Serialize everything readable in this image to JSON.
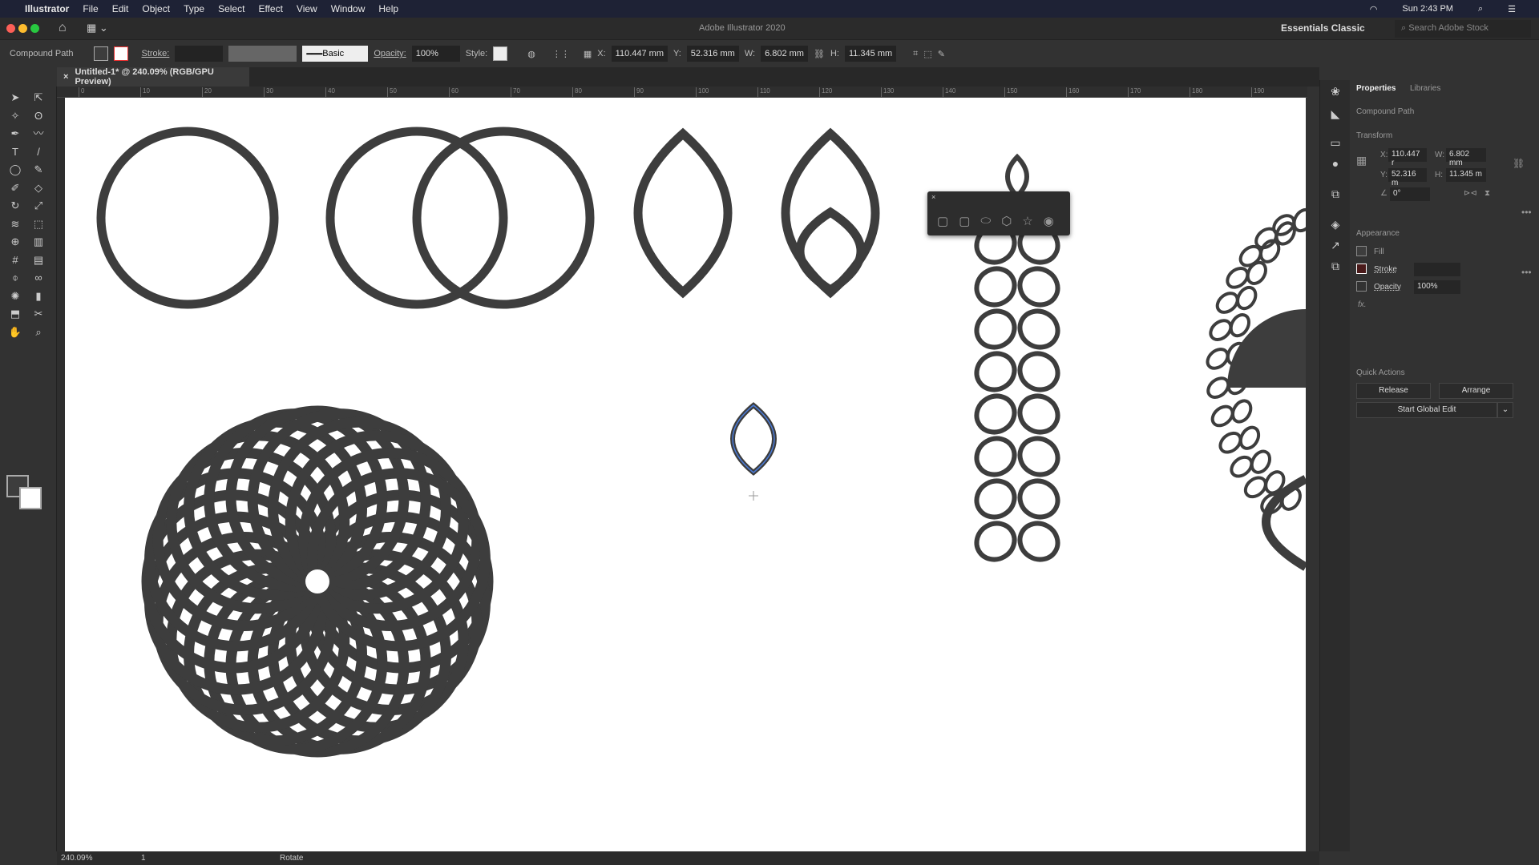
{
  "menubar": {
    "apple": "",
    "items": [
      "Illustrator",
      "File",
      "Edit",
      "Object",
      "Type",
      "Select",
      "Effect",
      "View",
      "Window",
      "Help"
    ],
    "clock": "Sun 2:43 PM"
  },
  "titlebar": {
    "title": "Adobe Illustrator 2020",
    "workspace": "Essentials Classic",
    "search_placeholder": "Search Adobe Stock"
  },
  "control": {
    "selection": "Compound Path",
    "stroke_label": "Stroke:",
    "brush": "Basic",
    "opacity_label": "Opacity:",
    "opacity": "100%",
    "style_label": "Style:",
    "x_label": "X:",
    "x": "110.447 mm",
    "y_label": "Y:",
    "y": "52.316 mm",
    "w_label": "W:",
    "w": "6.802 mm",
    "h_label": "H:",
    "h": "11.345 mm"
  },
  "document": {
    "tab": "Untitled-1* @ 240.09% (RGB/GPU Preview)"
  },
  "ruler": [
    "0",
    "10",
    "20",
    "30",
    "40",
    "50",
    "60",
    "70",
    "80",
    "90",
    "100",
    "110",
    "120",
    "130",
    "140",
    "150",
    "160",
    "170",
    "180",
    "190"
  ],
  "properties": {
    "tabs": [
      "Properties",
      "Libraries"
    ],
    "object": "Compound Path",
    "transform": "Transform",
    "x_label": "X:",
    "x": "110.447 r",
    "y_label": "Y:",
    "y": "52.316 m",
    "w_label": "W:",
    "w": "6.802 mm",
    "h_label": "H:",
    "h": "11.345 m",
    "angle": "0°",
    "appearance": "Appearance",
    "fill": "Fill",
    "stroke": "Stroke",
    "opacity": "Opacity",
    "opacity_value": "100%",
    "fx": "fx.",
    "quick_actions": "Quick Actions",
    "release": "Release",
    "arrange": "Arrange",
    "global_edit": "Start Global Edit"
  },
  "status": {
    "zoom": "240.09%",
    "artboard": "1",
    "tool": "Rotate"
  },
  "colors": {
    "artwork": "#3d3d3d",
    "selection": "#4a7bd8",
    "ui_bg": "#323232"
  }
}
